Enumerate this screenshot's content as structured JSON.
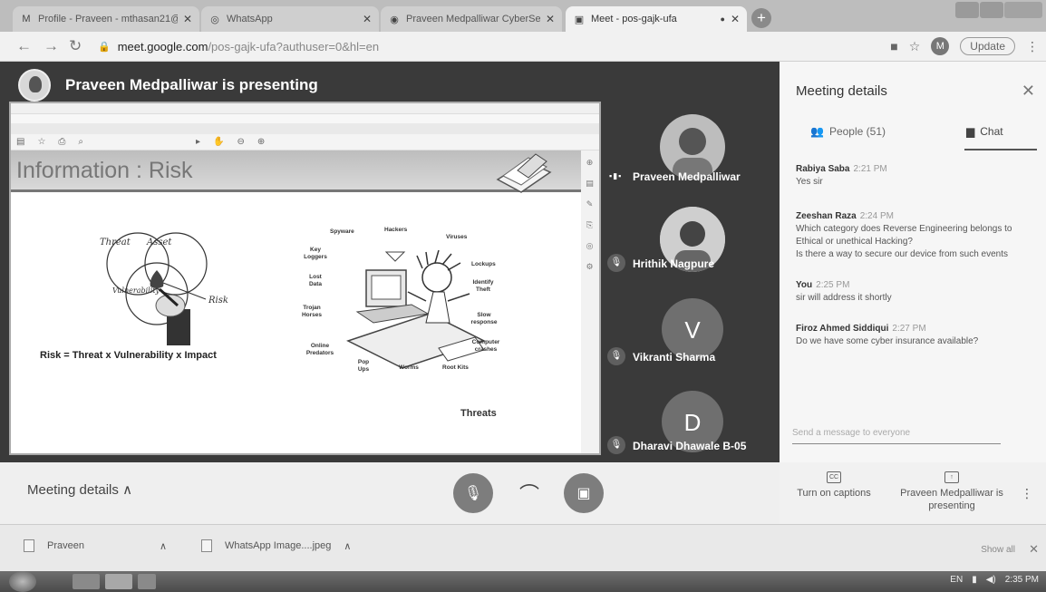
{
  "browser": {
    "tabs": [
      {
        "icon": "gmail-icon",
        "label": "Profile - Praveen - mthasan21@..."
      },
      {
        "icon": "whatsapp-icon",
        "label": "WhatsApp"
      },
      {
        "icon": "web-icon",
        "label": "Praveen Medpalliwar CyberSec..."
      },
      {
        "icon": "meet-icon",
        "label": "Meet - pos-gajk-ufa"
      }
    ],
    "url_host": "meet.google.com",
    "url_path": "/pos-gajk-ufa?authuser=0&hl=en",
    "profile_initial": "M",
    "update_label": "Update"
  },
  "stage": {
    "presenting_label": "Praveen Medpalliwar is presenting",
    "slide": {
      "title": "Information : Risk",
      "venn": {
        "threat": "Threat",
        "asset": "Asset",
        "vulnerability": "Vulnerability",
        "risk": "Risk"
      },
      "formula": "Risk = Threat x Vulnerability x Impact",
      "threat_labels": {
        "spyware": "Spyware",
        "hackers": "Hackers",
        "viruses": "Viruses",
        "key_loggers": "Key Loggers",
        "lost_data": "Lost Data",
        "lockups": "Lockups",
        "identity_theft": "Identify Theft",
        "trojan_horses": "Trojan Horses",
        "slow_response": "Slow response",
        "online_predators": "Online Predators",
        "computer_crashes": "Computer crashes",
        "pop_ups": "Pop Ups",
        "worms": "Worms",
        "root_kits": "Root Kits"
      },
      "caption": "Threats"
    },
    "participants": [
      {
        "name": "Praveen Medpalliwar",
        "initial": "",
        "speaking": true
      },
      {
        "name": "Hrithik Nagpure",
        "initial": "",
        "speaking": false
      },
      {
        "name": "Vikranti Sharma",
        "initial": "V",
        "speaking": false
      },
      {
        "name": "Dharavi Dhawale B-05",
        "initial": "D",
        "speaking": false
      }
    ]
  },
  "panel": {
    "title": "Meeting details",
    "people_tab": "People (51)",
    "chat_tab": "Chat",
    "messages": [
      {
        "sender": "Rabiya Saba",
        "time": "2:21 PM",
        "lines": [
          "Yes sir"
        ]
      },
      {
        "sender": "Zeeshan Raza",
        "time": "2:24 PM",
        "lines": [
          "Which category does Reverse Engineering belongs to Ethical or unethical Hacking?",
          "Is there a way to secure our device from such events"
        ]
      },
      {
        "sender": "You",
        "time": "2:25 PM",
        "lines": [
          "sir will address it shortly"
        ]
      },
      {
        "sender": "Firoz Ahmed Siddiqui",
        "time": "2:27 PM",
        "lines": [
          "Do we have some cyber insurance available?"
        ]
      }
    ],
    "compose_placeholder": "Send a message to everyone"
  },
  "controls": {
    "meeting_details": "Meeting details",
    "captions": "Turn on captions",
    "presenting": "Praveen Medpalliwar is presenting"
  },
  "downloads": [
    {
      "name": "Praveen"
    },
    {
      "name": "WhatsApp Image....jpeg"
    }
  ],
  "downloads_show_all": "Show all",
  "taskbar": {
    "lang": "EN",
    "time": "2:35 PM"
  }
}
